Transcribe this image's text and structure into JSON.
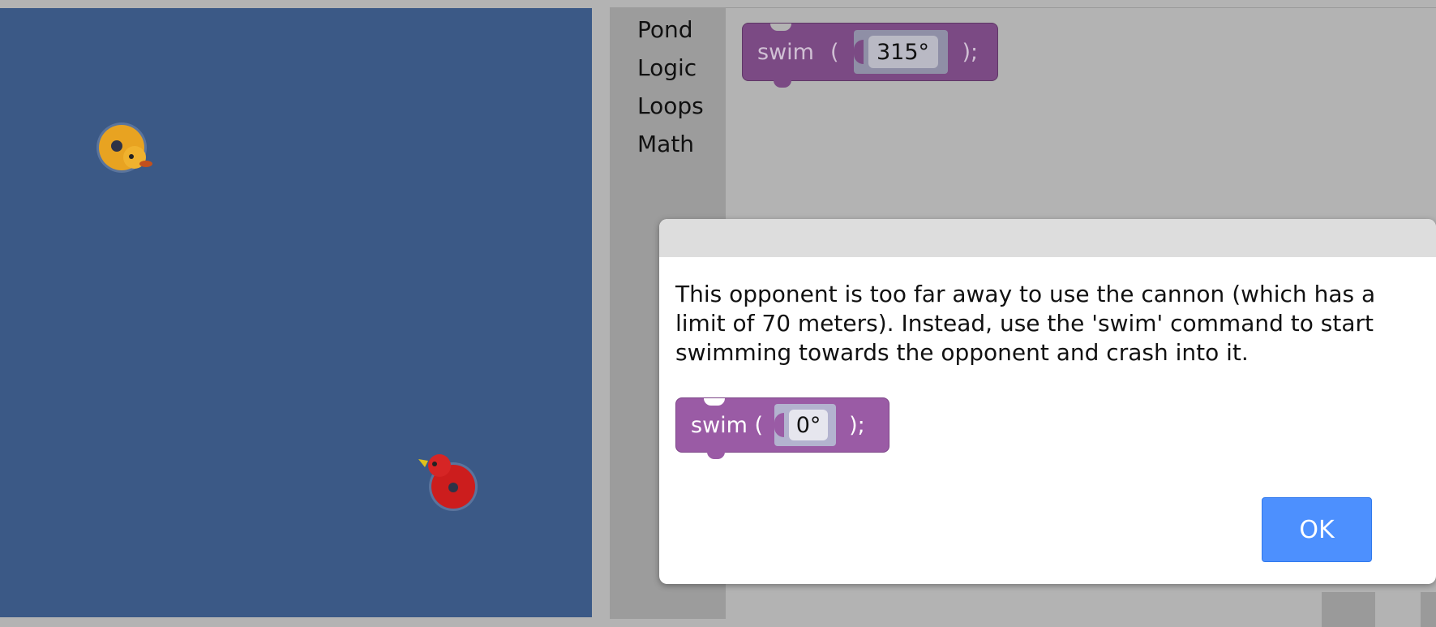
{
  "pond": {
    "ducks": [
      {
        "name": "yellow-duck",
        "color": "#e8a321"
      },
      {
        "name": "red-duck",
        "color": "#cc1d1d"
      }
    ]
  },
  "toolbox": {
    "categories": [
      {
        "label": "Pond"
      },
      {
        "label": "Logic"
      },
      {
        "label": "Loops"
      },
      {
        "label": "Math"
      }
    ]
  },
  "workspace": {
    "swim_block": {
      "prefix": "swim",
      "open_paren": "(",
      "angle": "315°",
      "suffix": ");",
      "color": "#7b4a84"
    }
  },
  "dialog": {
    "message": "This opponent is too far away to use the cannon (which has a limit of 70 meters). Instead, use the 'swim' command to start swimming towards the opponent and crash into it.",
    "example_block": {
      "prefix": "swim (",
      "angle": "0°",
      "suffix": ");",
      "color": "#9a5ba5"
    },
    "ok_label": "OK"
  }
}
